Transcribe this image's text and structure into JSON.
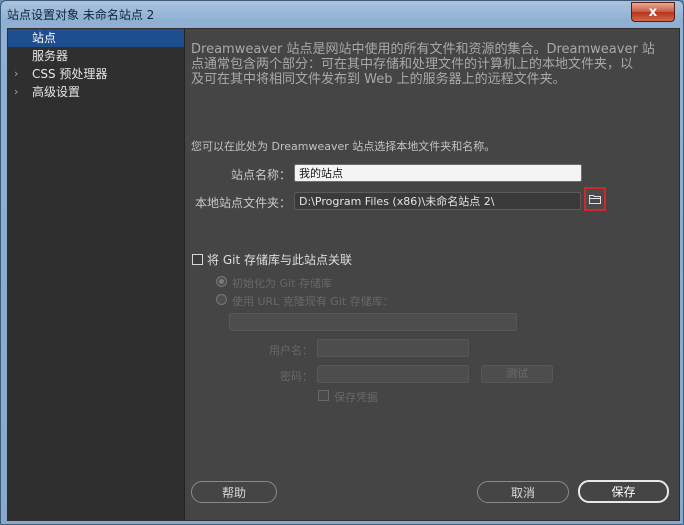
{
  "window": {
    "title": "站点设置对象 未命名站点 2",
    "close_label": "x"
  },
  "sidebar": {
    "items": [
      {
        "label": "站点",
        "selected": true,
        "expandable": false
      },
      {
        "label": "服务器",
        "selected": false,
        "expandable": false
      },
      {
        "label": "CSS 预处理器",
        "selected": false,
        "expandable": true
      },
      {
        "label": "高级设置",
        "selected": false,
        "expandable": true
      }
    ],
    "chevron": "›"
  },
  "main": {
    "intro_line1": "Dreamweaver 站点是网站中使用的所有文件和资源的集合。Dreamweaver 站",
    "intro_line2": "点通常包含两个部分：可在其中存储和处理文件的计算机上的本地文件夹，以",
    "intro_line3": "及可在其中将相同文件发布到 Web 上的服务器上的远程文件夹。",
    "hint": "您可以在此处为 Dreamweaver 站点选择本地文件夹和名称。",
    "site_name_label": "站点名称：",
    "site_name_value": "我的站点",
    "local_folder_label": "本地站点文件夹：",
    "local_folder_value": "D:\\Program Files (x86)\\未命名站点 2\\",
    "git": {
      "associate_label": "将 Git 存储库与此站点关联",
      "init_label": "初始化为 Git 存储库",
      "clone_label": "使用 URL 克隆现有 Git 存储库：",
      "username_label": "用户名：",
      "password_label": "密码：",
      "test_label": "测试",
      "save_credentials_label": "保存凭据"
    }
  },
  "footer": {
    "help_label": "帮助",
    "cancel_label": "取消",
    "save_label": "保存"
  },
  "colors": {
    "selection": "#1d4f8e",
    "panel": "#454545",
    "sidebar": "#2f2f2f",
    "highlight_border": "#d0282a"
  }
}
